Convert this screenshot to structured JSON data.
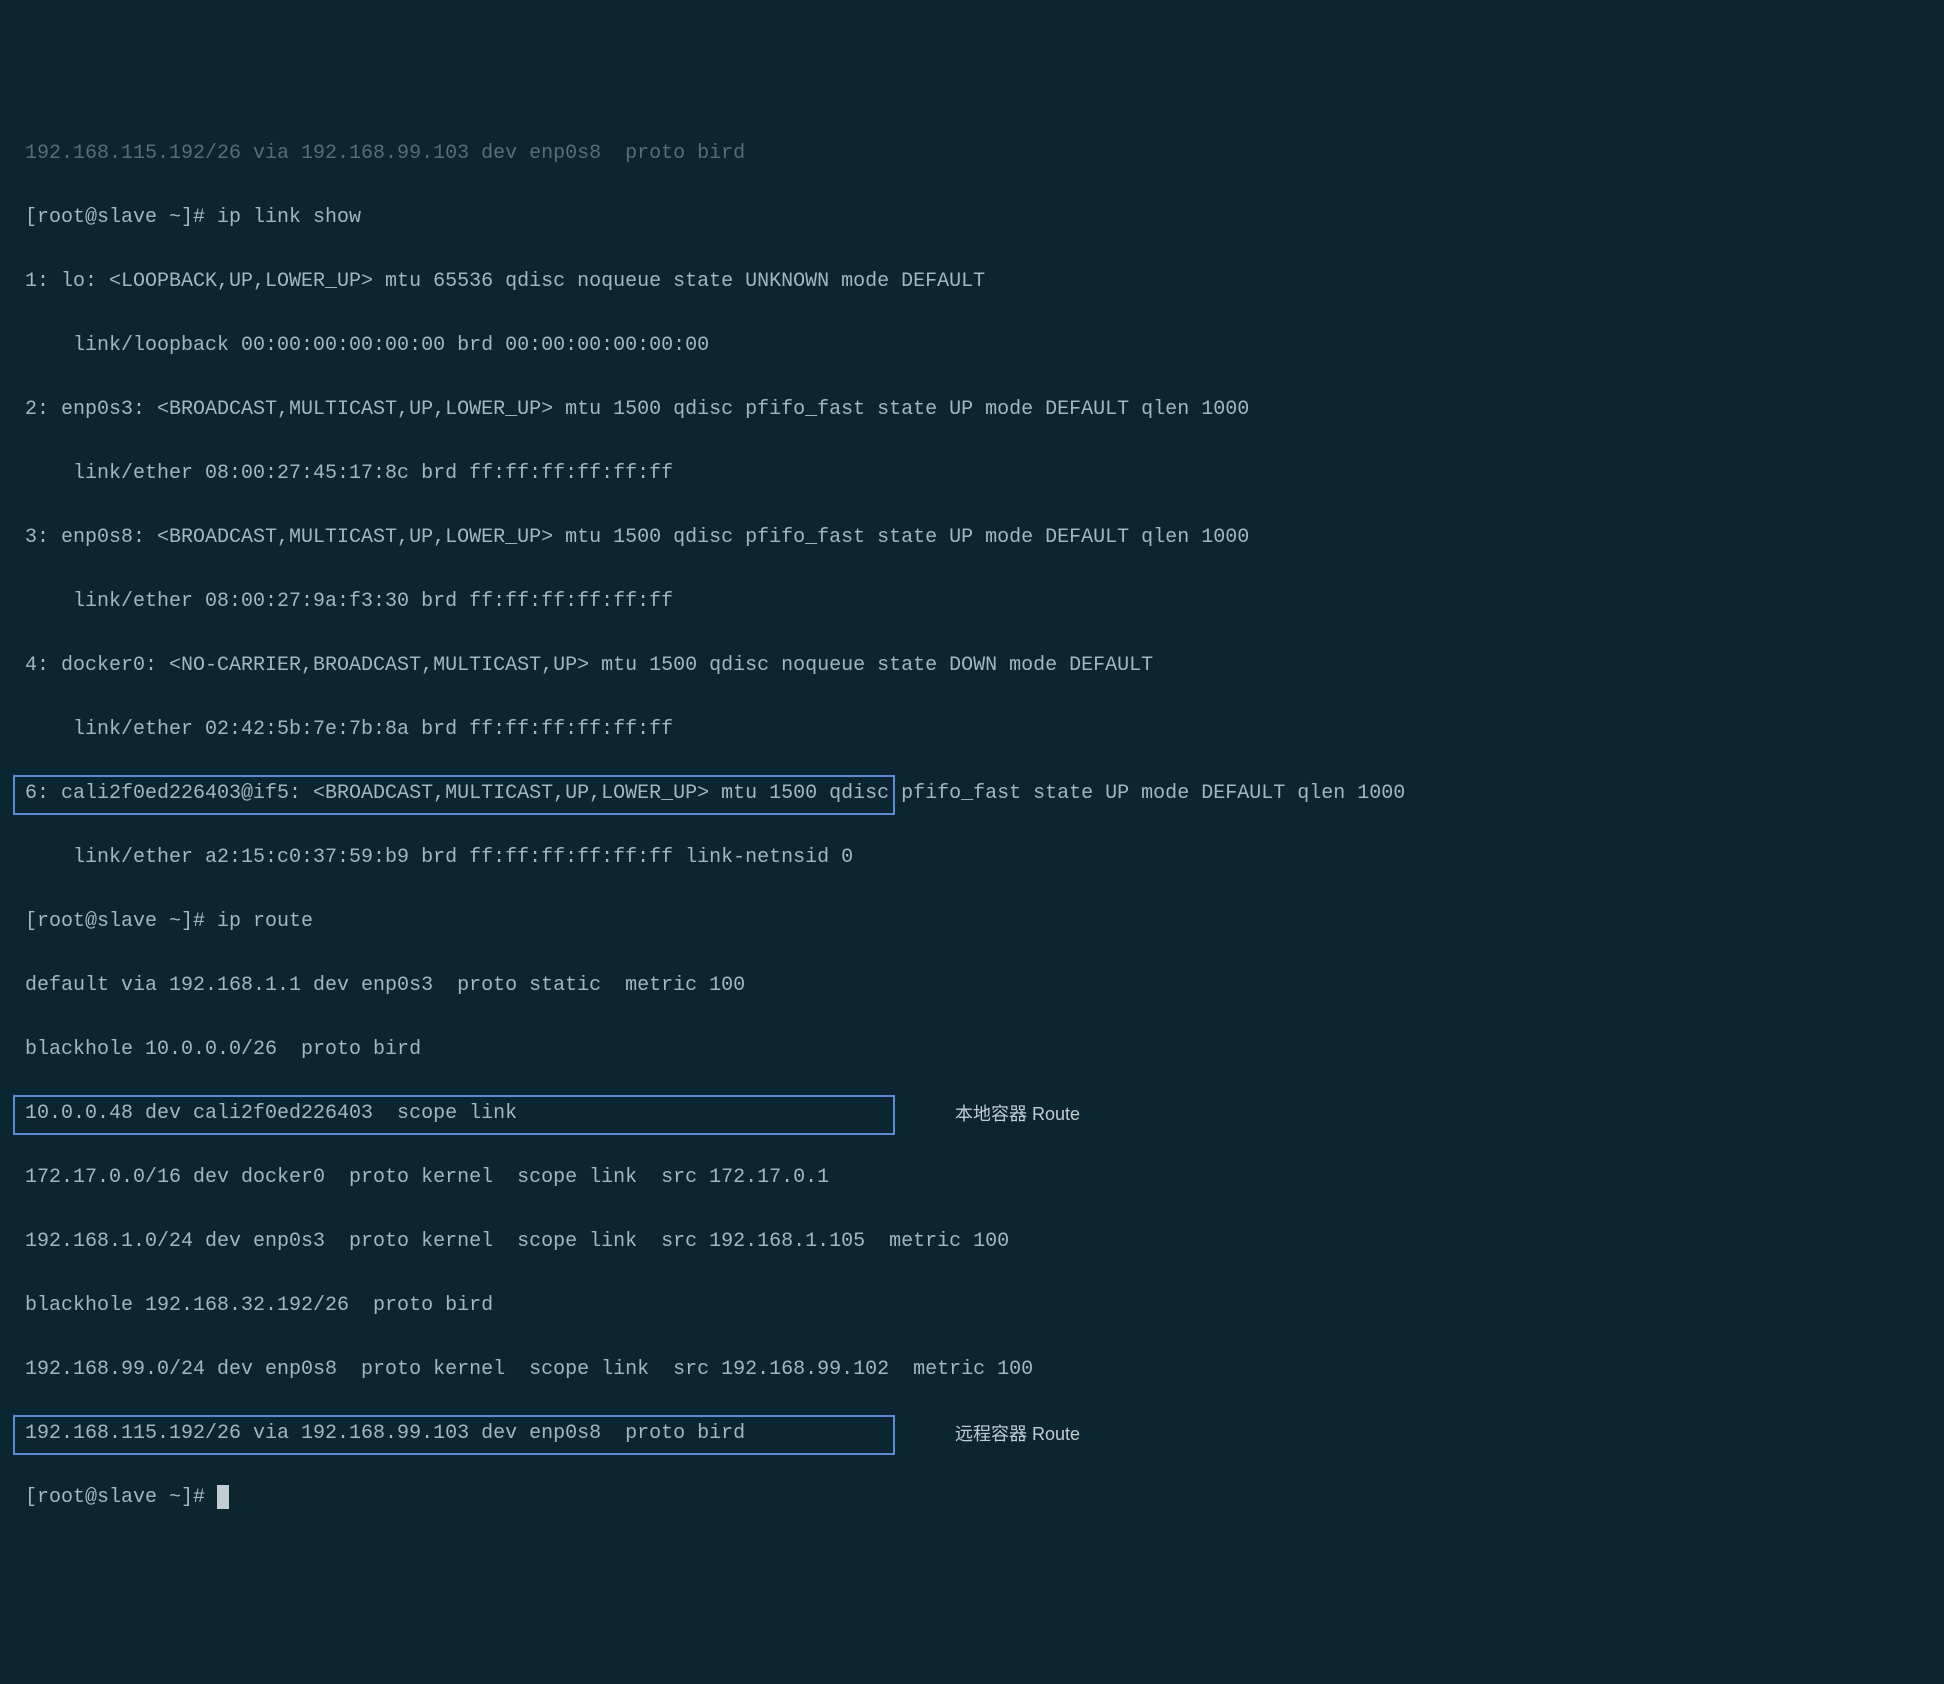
{
  "lines": {
    "l0": "192.168.115.192/26 via 192.168.99.103 dev enp0s8  proto bird",
    "l1": "[root@slave ~]# ip link show",
    "l2": "1: lo: <LOOPBACK,UP,LOWER_UP> mtu 65536 qdisc noqueue state UNKNOWN mode DEFAULT",
    "l3": "    link/loopback 00:00:00:00:00:00 brd 00:00:00:00:00:00",
    "l4": "2: enp0s3: <BROADCAST,MULTICAST,UP,LOWER_UP> mtu 1500 qdisc pfifo_fast state UP mode DEFAULT qlen 1000",
    "l5": "    link/ether 08:00:27:45:17:8c brd ff:ff:ff:ff:ff:ff",
    "l6": "3: enp0s8: <BROADCAST,MULTICAST,UP,LOWER_UP> mtu 1500 qdisc pfifo_fast state UP mode DEFAULT qlen 1000",
    "l7": "    link/ether 08:00:27:9a:f3:30 brd ff:ff:ff:ff:ff:ff",
    "l8": "4: docker0: <NO-CARRIER,BROADCAST,MULTICAST,UP> mtu 1500 qdisc noqueue state DOWN mode DEFAULT",
    "l9": "    link/ether 02:42:5b:7e:7b:8a brd ff:ff:ff:ff:ff:ff",
    "l10": "6: cali2f0ed226403@if5: <BROADCAST,MULTICAST,UP,LOWER_UP> mtu 1500 qdisc pfifo_fast state UP mode DEFAULT qlen 1000",
    "l11": "    link/ether a2:15:c0:37:59:b9 brd ff:ff:ff:ff:ff:ff link-netnsid 0",
    "l12": "[root@slave ~]# ip route",
    "l13": "default via 192.168.1.1 dev enp0s3  proto static  metric 100",
    "l14": "blackhole 10.0.0.0/26  proto bird",
    "l15": "10.0.0.48 dev cali2f0ed226403  scope link",
    "l16": "172.17.0.0/16 dev docker0  proto kernel  scope link  src 172.17.0.1",
    "l17": "192.168.1.0/24 dev enp0s3  proto kernel  scope link  src 192.168.1.105  metric 100",
    "l18": "blackhole 192.168.32.192/26  proto bird",
    "l19": "192.168.99.0/24 dev enp0s8  proto kernel  scope link  src 192.168.99.102  metric 100",
    "l20": "192.168.115.192/26 via 192.168.99.103 dev enp0s8  proto bird",
    "l21": "[root@slave ~]# "
  },
  "annotations": {
    "local_route": "本地容器 Route",
    "remote_route": "远程容器 Route"
  }
}
